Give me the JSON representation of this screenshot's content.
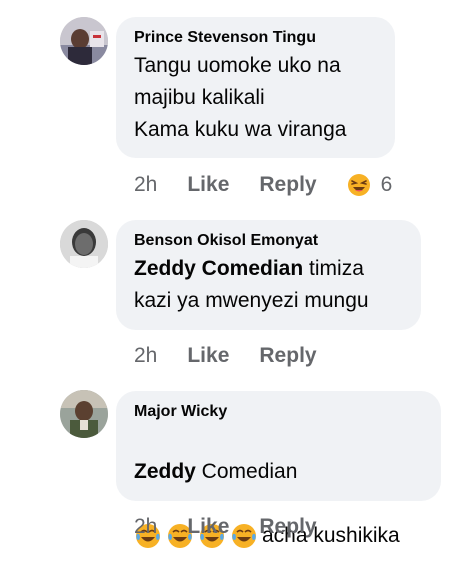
{
  "comments": [
    {
      "author": "Prince Stevenson Tingu",
      "text": "Tangu uomoke uko na\nmajibu kalikali\nKama kuku wa viranga",
      "time": "2h",
      "like": "Like",
      "reply": "Reply",
      "reaction_icon": "laughing-emoji",
      "reaction_count": "6"
    },
    {
      "author": "Benson Okisol Emonyat",
      "mention": "Zeddy Comedian",
      "text": " timiza\nkazi ya mwenyezi mungu",
      "time": "2h",
      "like": "Like",
      "reply": "Reply"
    },
    {
      "author": "Major Wicky",
      "mention": "Zeddy",
      "text_line1": " Comedian",
      "emoji_icon": "tears-of-joy-emoji",
      "text_line2": "acha kushikika",
      "time": "2h",
      "like": "Like",
      "reply": "Reply"
    }
  ]
}
